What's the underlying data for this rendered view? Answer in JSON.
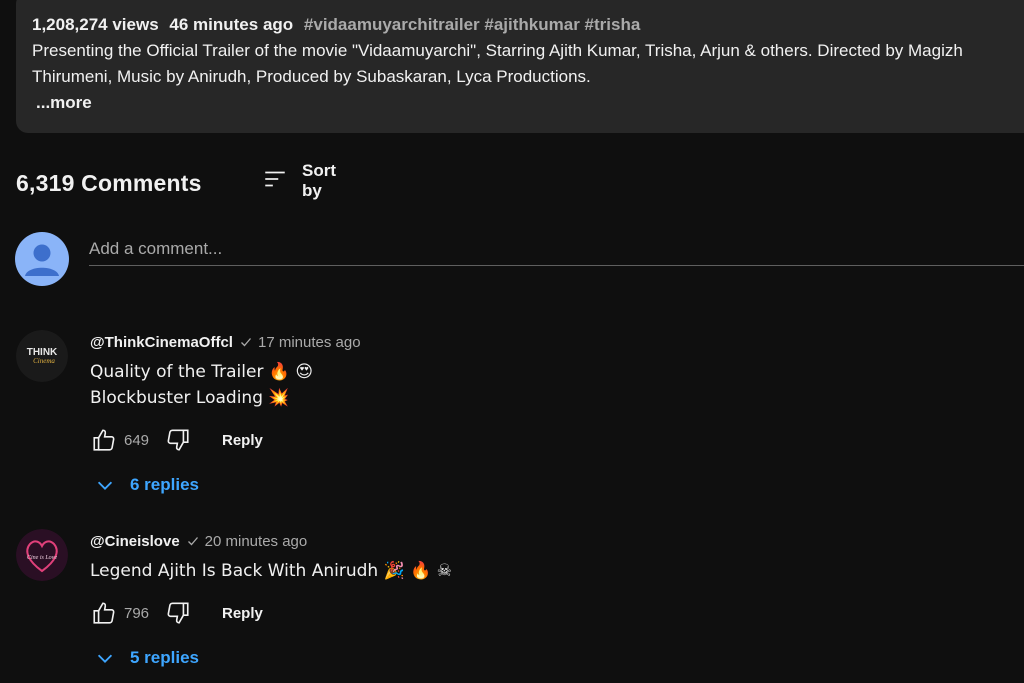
{
  "description": {
    "views": "1,208,274 views",
    "age": "46 minutes ago",
    "tags": "#vidaamuyarchitrailer #ajithkumar #trisha",
    "line1": "Presenting the Official Trailer of the movie \"Vidaamuyarchi\", Starring Ajith Kumar, Trisha, Arjun & others. Directed by Magizh",
    "line2": "Thirumeni, Music by Anirudh, Produced by Subaskaran, Lyca Productions.",
    "more_label": "...more"
  },
  "comments_header": {
    "count_label": "6,319 Comments",
    "sort_label": "Sort by"
  },
  "add_comment": {
    "placeholder": "Add a comment..."
  },
  "comments": [
    {
      "author": "@ThinkCinemaOffcl",
      "time": "17 minutes ago",
      "text": "Quality of the Trailer 🔥 😍\nBlockbuster Loading 💥",
      "likes": "649",
      "reply_label": "Reply",
      "replies_label": "6 replies",
      "avatar_text": "THINK",
      "avatar_subtext": "Cinema"
    },
    {
      "author": "@Cineislove",
      "time": "20 minutes ago",
      "text": "Legend Ajith Is Back With Anirudh 🎉 🔥 ☠",
      "likes": "796",
      "reply_label": "Reply",
      "replies_label": "5 replies",
      "avatar_text": "Cine is Love"
    }
  ],
  "colors": {
    "background": "#0f0f0f",
    "description_bg": "#272727",
    "link_blue": "#3ea6ff",
    "self_avatar": "#8ab4f8"
  }
}
